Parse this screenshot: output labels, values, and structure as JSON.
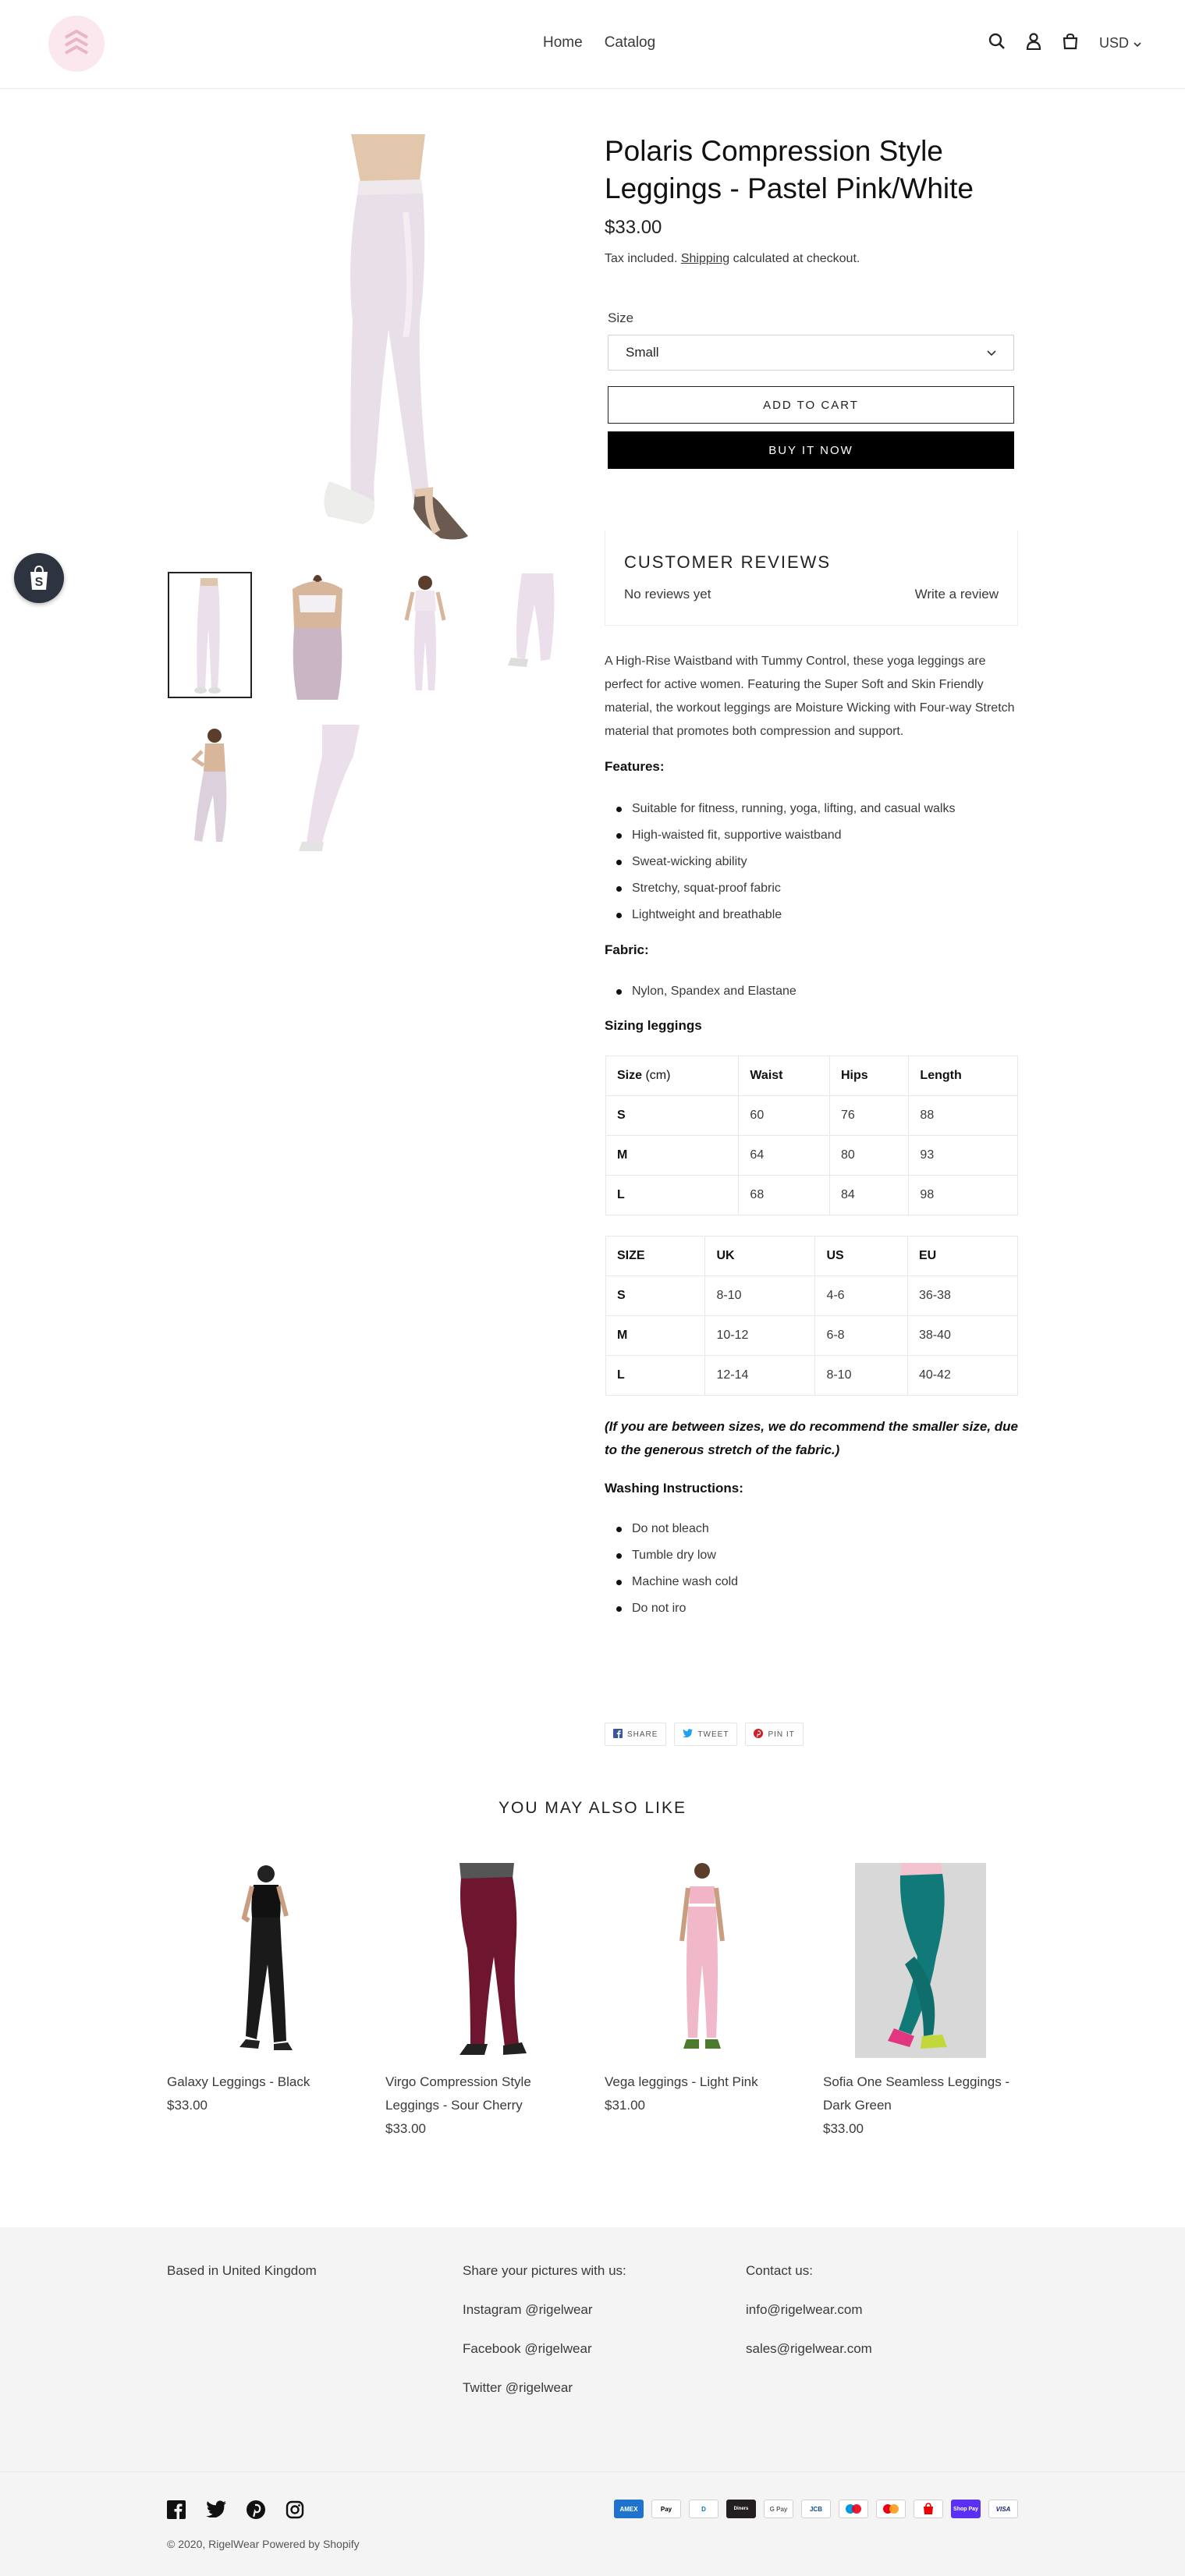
{
  "header": {
    "nav": [
      "Home",
      "Catalog"
    ],
    "currency": "USD"
  },
  "product": {
    "title": "Polaris Compression Style Leggings - Pastel Pink/White",
    "price": "$33.00",
    "tax_prefix": "Tax included. ",
    "tax_link": "Shipping",
    "tax_suffix": " calculated at checkout.",
    "size_label": "Size",
    "size_value": "Small",
    "add_to_cart": "ADD TO CART",
    "buy_now": "BUY IT NOW"
  },
  "reviews": {
    "title": "CUSTOMER REVIEWS",
    "none": "No reviews yet",
    "write": "Write a review"
  },
  "description": {
    "intro": "A High-Rise Waistband with Tummy Control, these yoga leggings are perfect for active women. Featuring the Super Soft and Skin Friendly material, the workout leggings are Moisture Wicking with Four-way Stretch material that promotes both compression and support.",
    "features_heading": "Features:",
    "features": [
      "Suitable for fitness, running, yoga, lifting, and casual walks",
      "High-waisted fit, supportive waistband",
      "Sweat-wicking ability",
      "Stretchy, squat-proof fabric",
      "Lightweight and breathable"
    ],
    "fabric_heading": "Fabric:",
    "fabric": [
      "Nylon, Spandex and Elastane"
    ],
    "sizing_heading": "Sizing leggings",
    "table1": {
      "headers": [
        "Size",
        "Waist",
        "Hips",
        "Length"
      ],
      "header_unit": "(cm)",
      "rows": [
        [
          "S",
          "60",
          "76",
          "88"
        ],
        [
          "M",
          "64",
          "80",
          "93"
        ],
        [
          "L",
          "68",
          "84",
          "98"
        ]
      ]
    },
    "table2": {
      "headers": [
        "SIZE",
        "UK",
        "US",
        "EU"
      ],
      "rows": [
        [
          "S",
          "8-10",
          "4-6",
          "36-38"
        ],
        [
          "M",
          "10-12",
          "6-8",
          "38-40"
        ],
        [
          "L",
          "12-14",
          "8-10",
          "40-42"
        ]
      ]
    },
    "note": "(If you are between sizes, we do recommend the smaller size, due to the generous stretch of the fabric.)",
    "washing_heading": "Washing Instructions:",
    "washing": [
      "Do not bleach",
      "Tumble dry low",
      "Machine wash cold",
      "Do not iro"
    ]
  },
  "share": [
    "SHARE",
    "TWEET",
    "PIN IT"
  ],
  "related": {
    "title": "YOU MAY ALSO LIKE",
    "items": [
      {
        "name": "Galaxy Leggings - Black",
        "price": "$33.00"
      },
      {
        "name": "Virgo Compression Style Leggings - Sour Cherry",
        "price": "$33.00"
      },
      {
        "name": "Vega leggings - Light Pink",
        "price": "$31.00"
      },
      {
        "name": "Sofia One Seamless Leggings - Dark Green",
        "price": "$33.00"
      }
    ]
  },
  "footer": {
    "col1": [
      "Based in United Kingdom"
    ],
    "col2": [
      "Share your pictures with us:",
      "Instagram @rigelwear",
      "Facebook @rigelwear",
      "Twitter @rigelwear"
    ],
    "col3": [
      "Contact us:",
      "info@rigelwear.com",
      "sales@rigelwear.com"
    ],
    "payments": [
      "AMEX",
      "Pay",
      "D",
      "Diners",
      "G Pay",
      "JCB",
      "MC",
      "MC",
      "Shop",
      "Shop Pay",
      "VISA"
    ],
    "copyright": "© 2020, RigelWear Powered by Shopify"
  },
  "colors": {
    "accent": "#000000",
    "brand_pink": "#fbe7ee",
    "footer_bg": "#f4f4f4"
  }
}
